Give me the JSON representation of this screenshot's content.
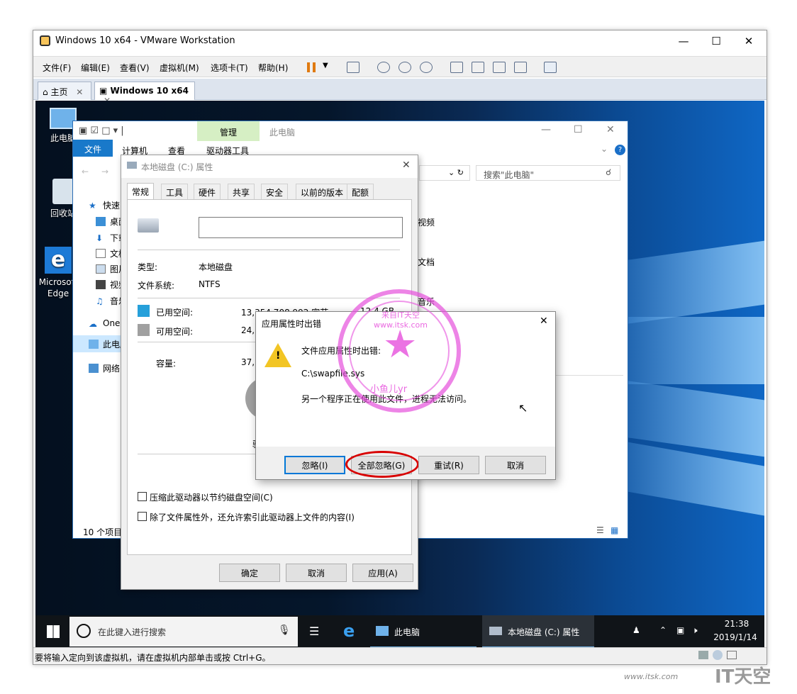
{
  "vmware": {
    "title": "Windows 10 x64 - VMware Workstation",
    "menu": [
      "文件(F)",
      "编辑(E)",
      "查看(V)",
      "虚拟机(M)",
      "选项卡(T)",
      "帮助(H)"
    ],
    "tabs": [
      {
        "label": "主页"
      },
      {
        "label": "Windows 10 x64"
      }
    ],
    "status": "要将输入定向到该虚拟机，请在虚拟机内部单击或按 Ctrl+G。"
  },
  "desktop": {
    "icons": [
      {
        "label": "此电脑"
      },
      {
        "label": "回收站"
      },
      {
        "label": "Microsoft Edge"
      }
    ]
  },
  "explorer": {
    "manage_tab": "管理",
    "title": "此电脑",
    "ribbon_tabs": [
      "文件",
      "计算机",
      "查看",
      "驱动器工具"
    ],
    "search_placeholder": "搜索\"此电脑\"",
    "nav": [
      "快速",
      "桌面",
      "下载",
      "文档",
      "图片",
      "视频",
      "音乐",
      "One",
      "此电脑",
      "网络"
    ],
    "folders": [
      "视频",
      "文档",
      "音乐"
    ],
    "item_count": "10 个项目"
  },
  "props": {
    "title": "本地磁盘 (C:) 属性",
    "tabs": [
      "常规",
      "工具",
      "硬件",
      "共享",
      "安全",
      "以前的版本",
      "配额"
    ],
    "name_value": "",
    "type_label": "类型:",
    "type_value": "本地磁盘",
    "fs_label": "文件系统:",
    "fs_value": "NTFS",
    "used_label": "已用空间:",
    "used_bytes": "13,354,708,992 字节",
    "used_gb": "12.4 GB",
    "free_label": "可用空间:",
    "free_bytes": "24,2",
    "cap_label": "容量:",
    "cap_bytes": "37,5",
    "drive_label": "驱",
    "compress": "压缩此驱动器以节约磁盘空间(C)",
    "index": "除了文件属性外，还允许索引此驱动器上文件的内容(I)",
    "ok": "确定",
    "cancel": "取消",
    "apply": "应用(A)"
  },
  "error": {
    "title": "应用属性时出错",
    "line1": "文件应用属性时出错:",
    "file": "C:\\swapfile.sys",
    "line2": "另一个程序正在使用此文件，进程无法访问。",
    "buttons": {
      "ignore": "忽略(I)",
      "ignore_all": "全部忽略(G)",
      "retry": "重试(R)",
      "cancel": "取消"
    }
  },
  "taskbar": {
    "search_placeholder": "在此键入进行搜索",
    "items": [
      "此电脑",
      "本地磁盘 (C:) 属性"
    ],
    "time": "21:38",
    "date": "2019/1/14"
  },
  "watermark": {
    "url": "www.itsk.com",
    "brand": "IT天空",
    "stamp_text": "来自IT天空 www.itsk.com",
    "stamp_author": "小鱼儿yr"
  },
  "colors": {
    "accent": "#0063b1",
    "used": "#26a0da",
    "free": "#a0a0a0",
    "highlight": "#d80000"
  }
}
